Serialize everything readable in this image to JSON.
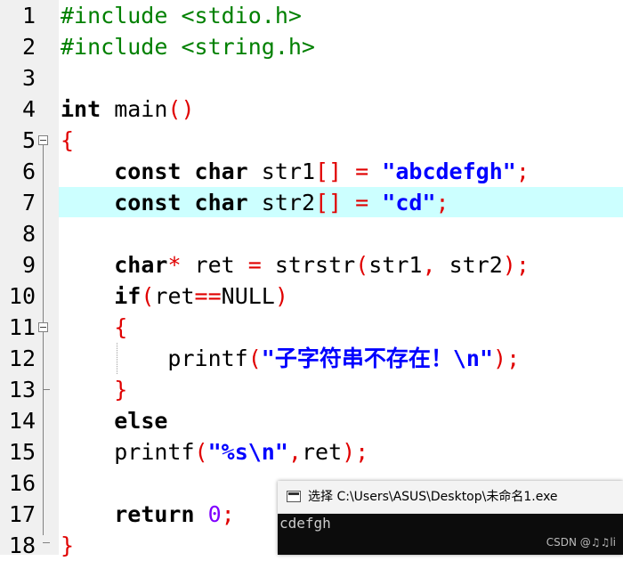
{
  "editor": {
    "line_numbers": [
      "1",
      "2",
      "3",
      "4",
      "5",
      "6",
      "7",
      "8",
      "9",
      "10",
      "11",
      "12",
      "13",
      "14",
      "15",
      "16",
      "17",
      "18"
    ],
    "code": {
      "l1": {
        "directive": "#include <stdio.h>"
      },
      "l2": {
        "directive": "#include <string.h>"
      },
      "l4": {
        "kw": "int",
        "name": " main",
        "punct": "()"
      },
      "l5": {
        "punct": "{"
      },
      "l6": {
        "indent": "    ",
        "kw": "const char",
        "name": " str1",
        "p1": "[]",
        "sp1": " ",
        "p2": "=",
        "sp2": " ",
        "string": "\"abcdefgh\"",
        "p3": ";"
      },
      "l7": {
        "indent": "    ",
        "kw": "const char",
        "name": " str2",
        "p1": "[]",
        "sp1": " ",
        "p2": "=",
        "sp2": " ",
        "string": "\"cd\"",
        "p3": ";"
      },
      "l9": {
        "indent": "    ",
        "kw": "char",
        "p1": "*",
        "t1": " ret ",
        "p2": "=",
        "t2": " strstr",
        "p3": "(",
        "t3": "str1",
        "p4": ",",
        "t4": " str2",
        "p5": ");"
      },
      "l10": {
        "indent": "    ",
        "kw": "if",
        "p1": "(",
        "t1": "ret",
        "p2": "==",
        "t2": "NULL",
        "p3": ")"
      },
      "l11": {
        "indent": "    ",
        "punct": "{"
      },
      "l12": {
        "indent": "        ",
        "t1": "printf",
        "p1": "(",
        "string": "\"子字符串不存在！\\n\"",
        "p2": ");"
      },
      "l13": {
        "indent": "    ",
        "punct": "}"
      },
      "l14": {
        "indent": "    ",
        "kw": "else"
      },
      "l15": {
        "indent": "    ",
        "t1": "printf",
        "p1": "(",
        "string": "\"%s\\n\"",
        "p2": ",",
        "t2": "ret",
        "p3": ");"
      },
      "l17": {
        "indent": "    ",
        "kw": "return",
        "sp": " ",
        "num": "0",
        "p1": ";"
      },
      "l18": {
        "punct": "}"
      }
    }
  },
  "console": {
    "title": "选择 C:\\Users\\ASUS\\Desktop\\未命名1.exe",
    "output": "cdefgh"
  },
  "watermark": "CSDN @♫♫li",
  "colors": {
    "preprocessor": "#008000",
    "keyword": "#000000",
    "punctuation": "#e00000",
    "string": "#0000ff",
    "number": "#8000ff",
    "current_line": "#ccffff",
    "gutter": "#f0f0f0"
  }
}
